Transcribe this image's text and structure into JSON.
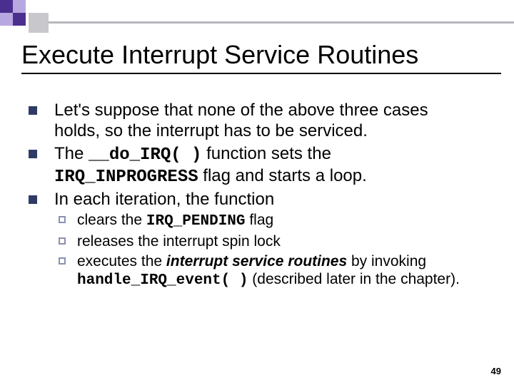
{
  "decor": {
    "purpleDark": "#4b2f8f",
    "purpleLight": "#b8a8e0",
    "grayBox": "#c8c8cc",
    "lineGray": "#b8b8bc"
  },
  "title": "Execute Interrupt Service Routines",
  "bullets": [
    {
      "segments": [
        {
          "t": "Let's suppose that none of the above three cases holds, so the interrupt has to be serviced."
        }
      ]
    },
    {
      "segments": [
        {
          "t": "The "
        },
        {
          "t": "__do_IRQ( )",
          "cls": "mono"
        },
        {
          "t": " function sets the "
        },
        {
          "t": "IRQ_INPROGRESS",
          "cls": "mono"
        },
        {
          "t": " flag and starts a loop."
        }
      ]
    },
    {
      "segments": [
        {
          "t": "In each iteration, the function"
        }
      ],
      "sub": [
        {
          "segments": [
            {
              "t": "clears the "
            },
            {
              "t": "IRQ_PENDING",
              "cls": "mono"
            },
            {
              "t": " flag"
            }
          ]
        },
        {
          "segments": [
            {
              "t": "releases the interrupt spin lock"
            }
          ]
        },
        {
          "segments": [
            {
              "t": "executes the "
            },
            {
              "t": "interrupt service routines",
              "cls": "bi"
            },
            {
              "t": " by invoking "
            },
            {
              "t": "handle_IRQ_event( )",
              "cls": "mono"
            },
            {
              "t": " (described later in the chapter)."
            }
          ]
        }
      ]
    }
  ],
  "pageNumber": "49"
}
